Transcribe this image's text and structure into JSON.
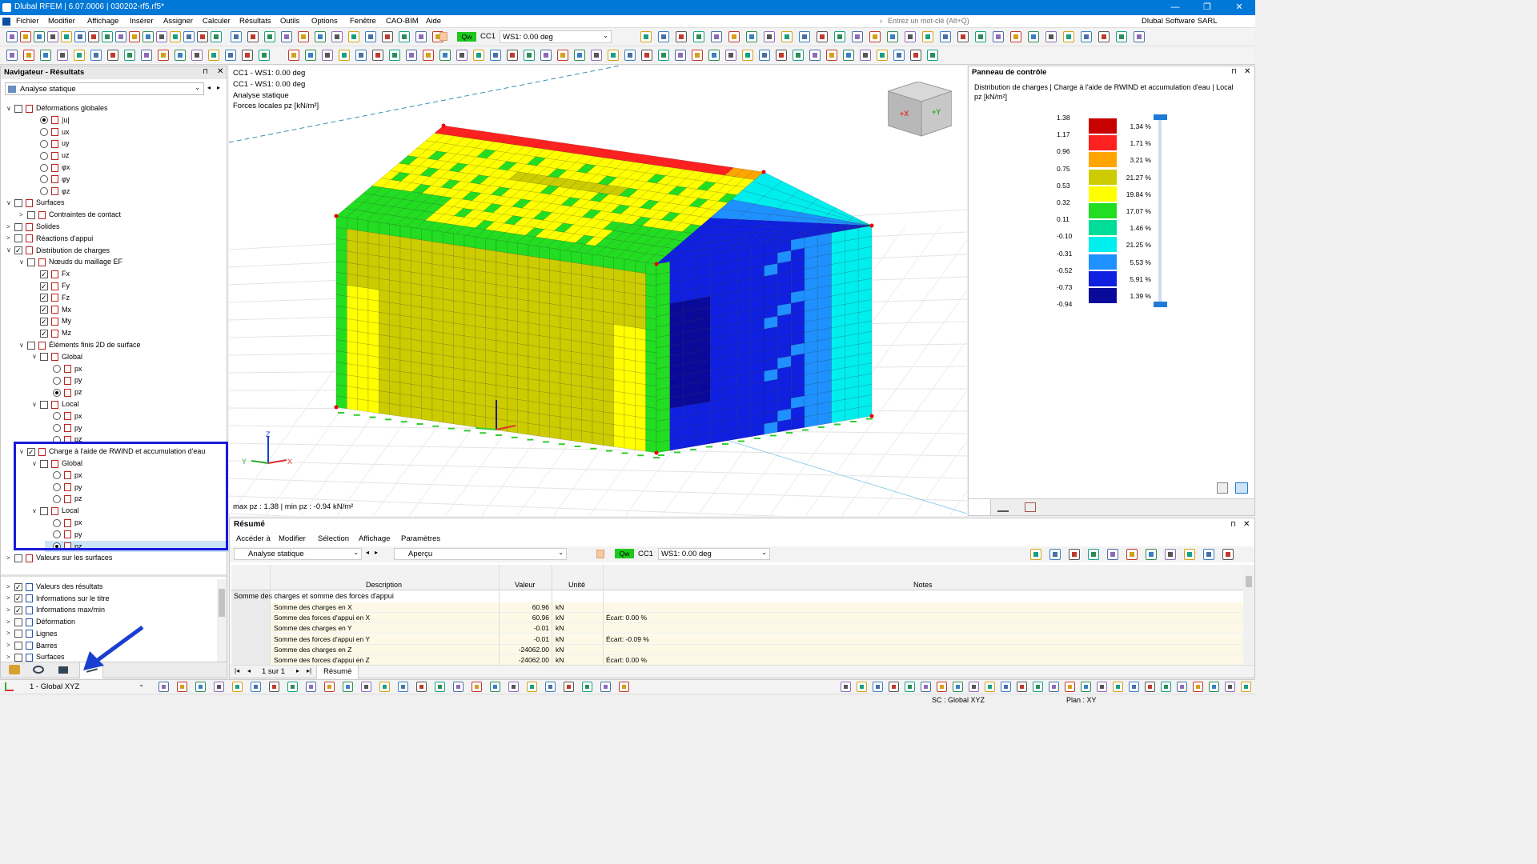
{
  "window": {
    "title": "Dlubal RFEM | 6.07.0006 | 030202-rf5.rf5*",
    "minimize": "—",
    "restore": "❐",
    "close": "✕"
  },
  "menu": {
    "items": [
      "Fichier",
      "Modifier",
      "Affichage",
      "Insérer",
      "Assigner",
      "Calculer",
      "Résultats",
      "Outils",
      "Options",
      "Fenêtre",
      "CAO-BIM",
      "Aide"
    ],
    "search_placeholder": "Entrez un mot-clé (Alt+Q)",
    "company": "Dlubal Software SARL"
  },
  "toolbar": {
    "loadcase_tag": "Qw",
    "loadcase_id": "CC1",
    "loadcase_name": "WS1: 0.00 deg"
  },
  "navigator": {
    "title": "Navigateur - Résultats",
    "analysis": "Analyse statique",
    "items": [
      {
        "label": "Déformations globales",
        "kind": "cb",
        "state": false,
        "indent": 0,
        "tw": "∨"
      },
      {
        "label": "|u|",
        "kind": "rd",
        "state": true,
        "indent": 2,
        "tw": ""
      },
      {
        "label": "ux",
        "kind": "rd",
        "state": false,
        "indent": 2,
        "tw": ""
      },
      {
        "label": "uy",
        "kind": "rd",
        "state": false,
        "indent": 2,
        "tw": ""
      },
      {
        "label": "uz",
        "kind": "rd",
        "state": false,
        "indent": 2,
        "tw": ""
      },
      {
        "label": "φx",
        "kind": "rd",
        "state": false,
        "indent": 2,
        "tw": ""
      },
      {
        "label": "φy",
        "kind": "rd",
        "state": false,
        "indent": 2,
        "tw": ""
      },
      {
        "label": "φz",
        "kind": "rd",
        "state": false,
        "indent": 2,
        "tw": ""
      },
      {
        "label": "Surfaces",
        "kind": "cb",
        "state": false,
        "indent": 0,
        "tw": "∨"
      },
      {
        "label": "Contraintes de contact",
        "kind": "cb",
        "state": false,
        "indent": 1,
        "tw": ">"
      },
      {
        "label": "Solides",
        "kind": "cb",
        "state": false,
        "indent": 0,
        "tw": ">"
      },
      {
        "label": "Réactions d'appui",
        "kind": "cb",
        "state": false,
        "indent": 0,
        "tw": ">"
      },
      {
        "label": "Distribution de charges",
        "kind": "cb",
        "state": true,
        "indent": 0,
        "tw": "∨"
      },
      {
        "label": "Nœuds du maillage EF",
        "kind": "cb",
        "state": false,
        "indent": 1,
        "tw": "∨"
      },
      {
        "label": "Fx",
        "kind": "cb",
        "state": true,
        "indent": 2,
        "tw": ""
      },
      {
        "label": "Fy",
        "kind": "cb",
        "state": true,
        "indent": 2,
        "tw": ""
      },
      {
        "label": "Fz",
        "kind": "cb",
        "state": true,
        "indent": 2,
        "tw": ""
      },
      {
        "label": "Mx",
        "kind": "cb",
        "state": true,
        "indent": 2,
        "tw": ""
      },
      {
        "label": "My",
        "kind": "cb",
        "state": true,
        "indent": 2,
        "tw": ""
      },
      {
        "label": "Mz",
        "kind": "cb",
        "state": true,
        "indent": 2,
        "tw": ""
      },
      {
        "label": "Éléments finis 2D de surface",
        "kind": "cb",
        "state": false,
        "indent": 1,
        "tw": "∨"
      },
      {
        "label": "Global",
        "kind": "cb",
        "state": false,
        "indent": 2,
        "tw": "∨"
      },
      {
        "label": "px",
        "kind": "rd",
        "state": false,
        "indent": 3,
        "tw": ""
      },
      {
        "label": "py",
        "kind": "rd",
        "state": false,
        "indent": 3,
        "tw": ""
      },
      {
        "label": "pz",
        "kind": "rd",
        "state": true,
        "indent": 3,
        "tw": ""
      },
      {
        "label": "Local",
        "kind": "cb",
        "state": false,
        "indent": 2,
        "tw": "∨"
      },
      {
        "label": "px",
        "kind": "rd",
        "state": false,
        "indent": 3,
        "tw": ""
      },
      {
        "label": "py",
        "kind": "rd",
        "state": false,
        "indent": 3,
        "tw": ""
      },
      {
        "label": "pz",
        "kind": "rd",
        "state": false,
        "indent": 3,
        "tw": ""
      },
      {
        "label": "Charge à l'aide de RWIND et accumulation d'eau",
        "kind": "cb",
        "state": true,
        "indent": 1,
        "tw": "∨"
      },
      {
        "label": "Global",
        "kind": "cb",
        "state": false,
        "indent": 2,
        "tw": "∨"
      },
      {
        "label": "px",
        "kind": "rd",
        "state": false,
        "indent": 3,
        "tw": ""
      },
      {
        "label": "py",
        "kind": "rd",
        "state": false,
        "indent": 3,
        "tw": ""
      },
      {
        "label": "pz",
        "kind": "rd",
        "state": false,
        "indent": 3,
        "tw": ""
      },
      {
        "label": "Local",
        "kind": "cb",
        "state": false,
        "indent": 2,
        "tw": "∨"
      },
      {
        "label": "px",
        "kind": "rd",
        "state": false,
        "indent": 3,
        "tw": ""
      },
      {
        "label": "py",
        "kind": "rd",
        "state": false,
        "indent": 3,
        "tw": ""
      },
      {
        "label": "pz",
        "kind": "rd",
        "state": true,
        "indent": 3,
        "tw": ""
      },
      {
        "label": "Valeurs sur les surfaces",
        "kind": "cb",
        "state": false,
        "indent": 0,
        "tw": ">"
      }
    ],
    "lower_items": [
      {
        "label": "Valeurs des résultats",
        "state": true
      },
      {
        "label": "Informations sur le titre",
        "state": true
      },
      {
        "label": "Informations max/min",
        "state": true
      },
      {
        "label": "Déformation",
        "state": false
      },
      {
        "label": "Lignes",
        "state": false
      },
      {
        "label": "Barres",
        "state": false
      },
      {
        "label": "Surfaces",
        "state": false
      }
    ]
  },
  "viewport": {
    "info": [
      "CC1 - WS1: 0.00 deg",
      "CC1 - WS1: 0.00 deg",
      "Analyse statique",
      "Forces locales pz [kN/m²]"
    ],
    "maxmin": "max pz : 1.38 | min pz : -0.94 kN/m²",
    "cube_x": "+X",
    "cube_y": "+Y",
    "axis_x": "X",
    "axis_y": "Y",
    "axis_z": "Z"
  },
  "control_panel": {
    "title": "Panneau de contrôle",
    "subtitle": "Distribution de charges | Charge à l'aide de RWIND et accumulation d'eau | Local",
    "unit": "pz [kN/m²]",
    "legend": [
      {
        "value": "1.38",
        "color": "#c80000",
        "pct": "1.34 %"
      },
      {
        "value": "1.17",
        "color": "#ff2020",
        "pct": "1.71 %"
      },
      {
        "value": "0.96",
        "color": "#ffa500",
        "pct": "3.21 %"
      },
      {
        "value": "0.75",
        "color": "#cccc00",
        "pct": "21.27 %"
      },
      {
        "value": "0.53",
        "color": "#ffff00",
        "pct": "19.84 %"
      },
      {
        "value": "0.32",
        "color": "#22dd22",
        "pct": "17.07 %"
      },
      {
        "value": "0.11",
        "color": "#00dd99",
        "pct": "1.46 %"
      },
      {
        "value": "-0.10",
        "color": "#00eeee",
        "pct": "21.25 %"
      },
      {
        "value": "-0.31",
        "color": "#1e90ff",
        "pct": "5.53 %"
      },
      {
        "value": "-0.52",
        "color": "#1020e0",
        "pct": "5.91 %"
      },
      {
        "value": "-0.73",
        "color": "#0a0a9a",
        "pct": "1.39 %"
      },
      {
        "value": "-0.94",
        "color": "",
        "pct": ""
      }
    ]
  },
  "summary": {
    "title": "Résumé",
    "menu": [
      "Accéder à",
      "Modifier",
      "Sélection",
      "Affichage",
      "Paramètres"
    ],
    "analysis": "Analyse statique",
    "view": "Aperçu",
    "lc_tag": "Qw",
    "lc_id": "CC1",
    "lc_name": "WS1: 0.00 deg",
    "headers": {
      "description": "Description",
      "value": "Valeur",
      "unit": "Unité",
      "notes": "Notes"
    },
    "group": "Somme des charges et somme des forces d'appui",
    "rows": [
      {
        "d": "Somme des charges en X",
        "v": "60.96",
        "u": "kN",
        "n": ""
      },
      {
        "d": "Somme des forces d'appui en X",
        "v": "60.96",
        "u": "kN",
        "n": "Écart: 0.00 %"
      },
      {
        "d": "Somme des charges en Y",
        "v": "-0.01",
        "u": "kN",
        "n": ""
      },
      {
        "d": "Somme des forces d'appui en Y",
        "v": "-0.01",
        "u": "kN",
        "n": "Écart: -0.09 %"
      },
      {
        "d": "Somme des charges en Z",
        "v": "-24062.00",
        "u": "kN",
        "n": ""
      },
      {
        "d": "Somme des forces d'appui en Z",
        "v": "-24062.00",
        "u": "kN",
        "n": "Écart: 0.00 %"
      }
    ],
    "pager": "1 sur 1",
    "tab": "Résumé"
  },
  "status": {
    "coord": "1 - Global XYZ",
    "sc": "SC : Global XYZ",
    "plan": "Plan : XY"
  },
  "colors": {
    "accent": "#0078d7",
    "highlight_box": "#1a1adc",
    "arrow": "#1a3fd0"
  }
}
